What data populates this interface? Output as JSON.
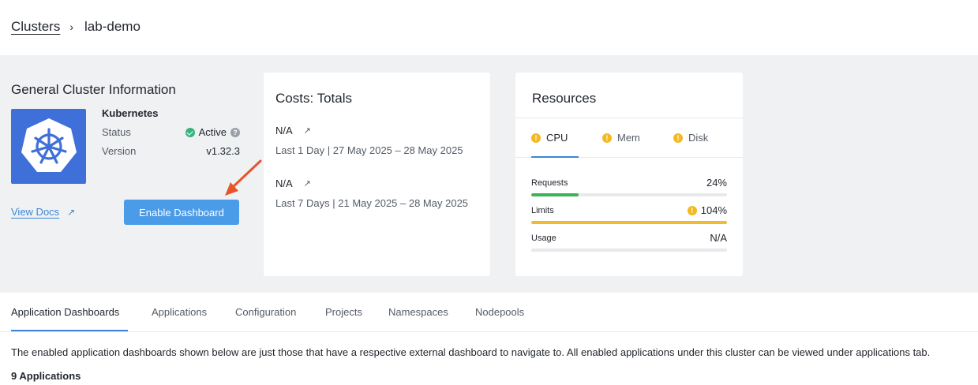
{
  "breadcrumb": {
    "root": "Clusters",
    "separator": "›",
    "current": "lab-demo"
  },
  "general": {
    "title": "General Cluster Information",
    "name": "Kubernetes",
    "status_label": "Status",
    "status_value": "Active",
    "version_label": "Version",
    "version_value": "v1.32.3",
    "view_docs": "View Docs",
    "enable_button": "Enable Dashboard"
  },
  "costs": {
    "title": "Costs: Totals",
    "items": [
      {
        "value": "N/A",
        "range": "Last 1 Day | 27 May 2025 – 28 May 2025"
      },
      {
        "value": "N/A",
        "range": "Last 7 Days | 21 May 2025 – 28 May 2025"
      }
    ]
  },
  "resources": {
    "title": "Resources",
    "tabs": [
      {
        "label": "CPU",
        "active": true
      },
      {
        "label": "Mem",
        "active": false
      },
      {
        "label": "Disk",
        "active": false
      }
    ],
    "metrics": [
      {
        "label": "Requests",
        "value": "24%",
        "fill": 0.24,
        "color": "#3cb356",
        "warn": false
      },
      {
        "label": "Limits",
        "value": "104%",
        "fill": 1.0,
        "color": "#f0bb2c",
        "warn": true
      },
      {
        "label": "Usage",
        "value": "N/A",
        "fill": 0,
        "color": "#e7e9ec",
        "warn": false
      }
    ]
  },
  "tabs": [
    "Application Dashboards",
    "Applications",
    "Configuration",
    "Projects",
    "Namespaces",
    "Nodepools"
  ],
  "description": "The enabled application dashboards shown below are just those that have a respective external dashboard to navigate to. All enabled applications under this cluster can be viewed under applications tab.",
  "app_count": "9 Applications",
  "colors": {
    "accent": "#3a86d6",
    "button": "#4a9be8",
    "logo": "#3f6fd8",
    "arrow": "#e8542a"
  }
}
